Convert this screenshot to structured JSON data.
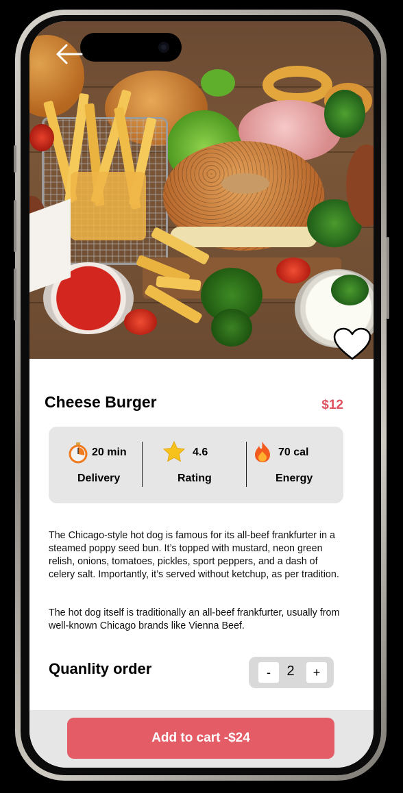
{
  "product": {
    "title": "Cheese Burger",
    "price": "$12"
  },
  "stats": [
    {
      "icon": "stopwatch-icon",
      "value": "20 min",
      "label": "Delivery"
    },
    {
      "icon": "star-icon",
      "value": "4.6",
      "label": "Rating"
    },
    {
      "icon": "fire-icon",
      "value": "70 cal",
      "label": "Energy"
    }
  ],
  "description": {
    "paragraph1": "The Chicago-style hot dog is famous for its all-beef frankfurter in a steamed poppy seed bun. It’s topped with mustard, neon green relish, onions, tomatoes, pickles, sport peppers, and a dash of celery salt. Importantly, it’s served without ketchup, as per tradition.",
    "paragraph2": "The hot dog itself is traditionally an all-beef frankfurter, usually from well-known Chicago brands like Vienna Beef."
  },
  "quantity": {
    "label": "Quanlity order",
    "decrement": "-",
    "value": "2",
    "increment": "+"
  },
  "cart": {
    "label": "Add to cart -$24"
  },
  "colors": {
    "accent": "#e45c66",
    "price": "#e05260",
    "stats_bg": "#e6e6e6"
  }
}
